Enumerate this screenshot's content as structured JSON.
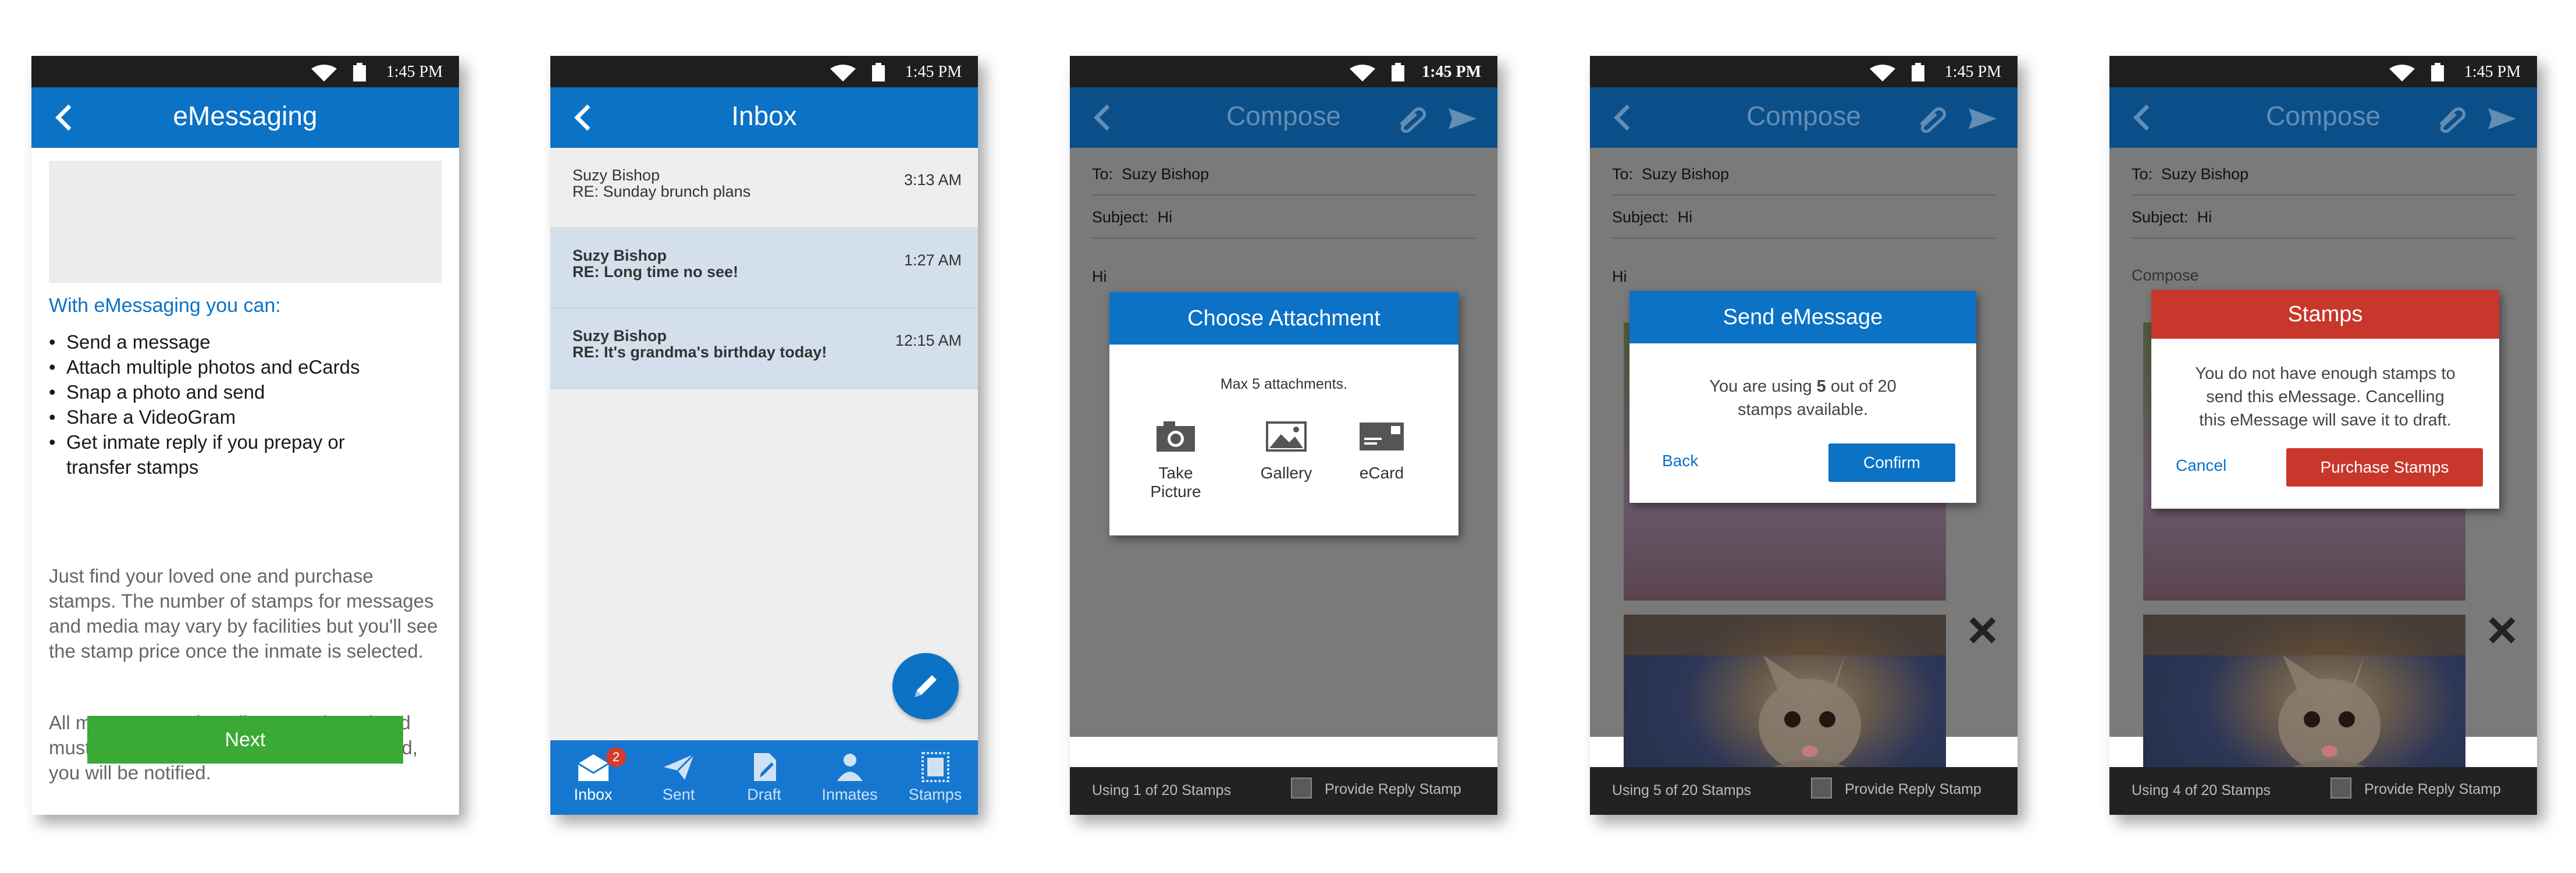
{
  "status": {
    "time": "1:45 PM"
  },
  "screens": {
    "intro": {
      "title": "eMessaging",
      "lead": "With eMessaging you can:",
      "bullets": [
        "Send a message",
        "Attach multiple photos and eCards",
        "Snap a photo and send",
        "Share a VideoGram",
        "Get inmate reply if you prepay or transfer stamps"
      ],
      "para1": "Just find your loved one and purchase stamps. The number of stamps for messages and media may vary by facilities but you'll see the stamp price once the inmate is selected.",
      "para2": "All messages and media are reviewed and must be approved by the facility. If rejected, you will be notified.",
      "next": "Next"
    },
    "inbox": {
      "title": "Inbox",
      "messages": [
        {
          "sender": "Suzy Bishop",
          "subject": "RE:  Sunday brunch plans",
          "time": "3:13 AM",
          "unread": false
        },
        {
          "sender": "Suzy Bishop",
          "subject": "RE: Long time no see!",
          "time": "1:27 AM",
          "unread": true
        },
        {
          "sender": "Suzy Bishop",
          "subject": "RE: It's grandma's birthday today!",
          "time": "12:15 AM",
          "unread": true
        }
      ],
      "tabs": [
        "Inbox",
        "Sent",
        "Draft",
        "Inmates",
        "Stamps"
      ],
      "badge": "2"
    },
    "attach": {
      "title": "Compose",
      "to_label": "To:",
      "to": "Suzy Bishop",
      "subject_label": "Subject:",
      "subject": "Hi",
      "body": "Hi",
      "dialog_title": "Choose Attachment",
      "dialog_note": "Max 5 attachments.",
      "options": [
        "Take Picture",
        "Gallery",
        "eCard"
      ],
      "using": "Using 1 of 20 Stamps",
      "reply": "Provide Reply Stamp"
    },
    "send": {
      "title": "Compose",
      "to_label": "To:",
      "to": "Suzy Bishop",
      "subject_label": "Subject:",
      "subject": "Hi",
      "body": "Hi",
      "dialog_title": "Send eMessage",
      "msg_pre": "You are using ",
      "msg_count": "5",
      "msg_post": " out of 20",
      "msg_line2": "stamps available.",
      "back": "Back",
      "confirm": "Confirm",
      "using": "Using 5 of 20 Stamps",
      "reply": "Provide Reply Stamp"
    },
    "stamps": {
      "title": "Compose",
      "to_label": "To:",
      "to": "Suzy Bishop",
      "subject_label": "Subject:",
      "subject": "Hi",
      "body": "Compose",
      "dialog_title": "Stamps",
      "msg_lines": [
        "You do not have enough stamps to",
        "send this eMessage. Cancelling",
        "this eMessage will save it to draft."
      ],
      "cancel": "Cancel",
      "purchase": "Purchase Stamps",
      "using": "Using 4 of 20 Stamps",
      "reply": "Provide Reply Stamp"
    }
  },
  "colors": {
    "blue": "#0b72c6",
    "green": "#3aa935",
    "red": "#c8372b"
  }
}
